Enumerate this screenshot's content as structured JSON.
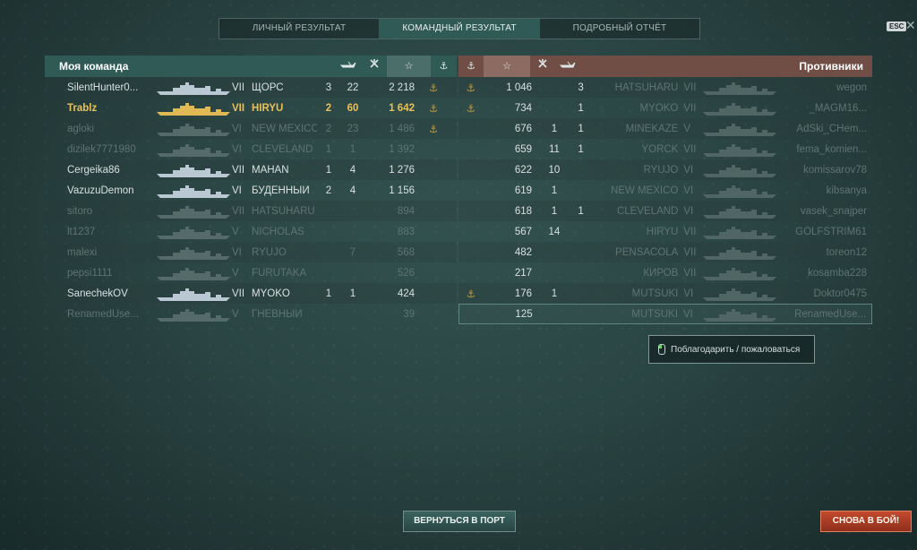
{
  "tabs": [
    {
      "label": "ЛИЧНЫЙ РЕЗУЛЬТАТ",
      "active": false
    },
    {
      "label": "КОМАНДНЫЙ РЕЗУЛЬТАТ",
      "active": true
    },
    {
      "label": "ПОДРОБНЫЙ ОТЧЁТ",
      "active": false
    }
  ],
  "esc_label": "ESC",
  "close_glyph": "✕",
  "left_team": {
    "title": "Моя команда",
    "icons": [
      "ship-sunk-icon",
      "plane-shot-icon",
      "star-icon",
      "anchor-icon"
    ],
    "star_glyph": "☆",
    "anchor_glyph": "⚓",
    "players": [
      {
        "name": "SilentHunter0...",
        "tier": "VII",
        "ship": "ЩОРС",
        "kills": "3",
        "planes": "22",
        "xp": "2 218",
        "anchor": true,
        "state": "alive"
      },
      {
        "name": "Trablz",
        "tier": "VII",
        "ship": "HIRYU",
        "kills": "2",
        "planes": "60",
        "xp": "1 642",
        "anchor": true,
        "state": "self"
      },
      {
        "name": "agloki",
        "tier": "VI",
        "ship": "NEW MEXICO",
        "kills": "2",
        "planes": "23",
        "xp": "1 486",
        "anchor": true,
        "state": "dead"
      },
      {
        "name": "dizilek7771980",
        "tier": "VI",
        "ship": "CLEVELAND",
        "kills": "1",
        "planes": "1",
        "xp": "1 392",
        "anchor": false,
        "state": "dead"
      },
      {
        "name": "Cergeika86",
        "tier": "VII",
        "ship": "MAHAN",
        "kills": "1",
        "planes": "4",
        "xp": "1 276",
        "anchor": false,
        "state": "alive"
      },
      {
        "name": "VazuzuDemon",
        "tier": "VI",
        "ship": "БУДЁННЫЙ",
        "kills": "2",
        "planes": "4",
        "xp": "1 156",
        "anchor": false,
        "state": "alive"
      },
      {
        "name": "sitoro",
        "tier": "VII",
        "ship": "HATSUHARU",
        "kills": "",
        "planes": "",
        "xp": "894",
        "anchor": false,
        "state": "dead"
      },
      {
        "name": "lt1237",
        "tier": "V",
        "ship": "NICHOLAS",
        "kills": "",
        "planes": "",
        "xp": "883",
        "anchor": false,
        "state": "dead"
      },
      {
        "name": "malexi",
        "tier": "VI",
        "ship": "RYUJO",
        "kills": "",
        "planes": "7",
        "xp": "568",
        "anchor": false,
        "state": "dead"
      },
      {
        "name": "pepsi1111",
        "tier": "V",
        "ship": "FURUTAKA",
        "kills": "",
        "planes": "",
        "xp": "526",
        "anchor": false,
        "state": "dead"
      },
      {
        "name": "SanechekOV",
        "tier": "VII",
        "ship": "MYOKO",
        "kills": "1",
        "planes": "1",
        "xp": "424",
        "anchor": false,
        "state": "alive"
      },
      {
        "name": "RenamedUse...",
        "tier": "V",
        "ship": "ГНЕВНЫЙ",
        "kills": "",
        "planes": "",
        "xp": "39",
        "anchor": false,
        "state": "dead"
      }
    ]
  },
  "right_team": {
    "title": "Противники",
    "players": [
      {
        "name": "wegon",
        "tier": "VII",
        "ship": "HATSUHARU",
        "kills": "3",
        "planes": "",
        "xp": "1 046",
        "anchor": true
      },
      {
        "name": "_MAGM16...",
        "tier": "VII",
        "ship": "MYOKO",
        "kills": "1",
        "planes": "",
        "xp": "734",
        "anchor": true
      },
      {
        "name": "AdSki_CHem...",
        "tier": "V",
        "ship": "MINEKAZE",
        "kills": "1",
        "planes": "1",
        "xp": "676",
        "anchor": false
      },
      {
        "name": "fema_komien...",
        "tier": "VII",
        "ship": "YORCK",
        "kills": "1",
        "planes": "11",
        "xp": "659",
        "anchor": false
      },
      {
        "name": "komissarov78",
        "tier": "VI",
        "ship": "RYUJO",
        "kills": "",
        "planes": "10",
        "xp": "622",
        "anchor": false
      },
      {
        "name": "kibsanya",
        "tier": "VI",
        "ship": "NEW MEXICO",
        "kills": "",
        "planes": "1",
        "xp": "619",
        "anchor": false
      },
      {
        "name": "vasek_snajper",
        "tier": "VI",
        "ship": "CLEVELAND",
        "kills": "1",
        "planes": "1",
        "xp": "618",
        "anchor": false
      },
      {
        "name": "GOLFSTRIM61",
        "tier": "VII",
        "ship": "HIRYU",
        "kills": "",
        "planes": "14",
        "xp": "567",
        "anchor": false
      },
      {
        "name": "toreon12",
        "tier": "VII",
        "ship": "PENSACOLA",
        "kills": "",
        "planes": "",
        "xp": "482",
        "anchor": false
      },
      {
        "name": "kosamba228",
        "tier": "VII",
        "ship": "КИРОВ",
        "kills": "",
        "planes": "",
        "xp": "217",
        "anchor": false
      },
      {
        "name": "Doktor0475",
        "tier": "VI",
        "ship": "MUTSUKI",
        "kills": "",
        "planes": "1",
        "xp": "176",
        "anchor": true
      },
      {
        "name": "RenamedUse...",
        "tier": "VI",
        "ship": "MUTSUKI",
        "kills": "",
        "planes": "",
        "xp": "125",
        "anchor": false
      }
    ]
  },
  "thank_label": "Поблагодарить / пожаловаться",
  "buttons": {
    "port": "ВЕРНУТЬСЯ В ПОРТ",
    "battle": "СНОВА В БОЙ!"
  }
}
